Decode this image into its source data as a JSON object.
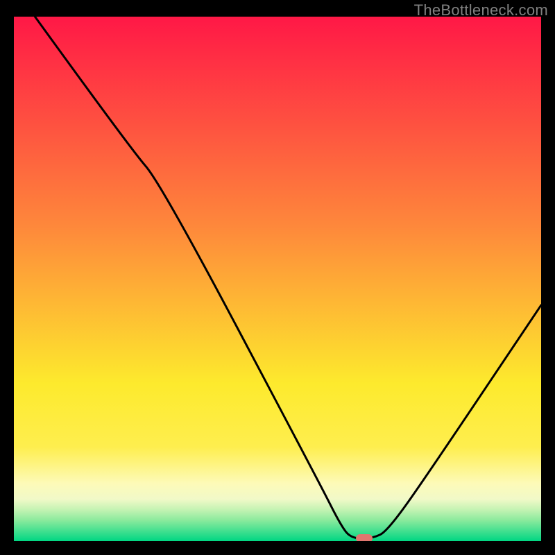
{
  "watermark": "TheBottleneck.com",
  "chart_data": {
    "type": "line",
    "title": "",
    "xlabel": "",
    "ylabel": "",
    "xlim": [
      0,
      100
    ],
    "ylim": [
      0,
      100
    ],
    "grid": false,
    "legend": false,
    "annotations": [],
    "background_gradient": {
      "stops": [
        {
          "offset": 0,
          "color": "#ff1846"
        },
        {
          "offset": 40,
          "color": "#fe883b"
        },
        {
          "offset": 70,
          "color": "#fdea2d"
        },
        {
          "offset": 82,
          "color": "#feee4e"
        },
        {
          "offset": 89,
          "color": "#fdfab8"
        },
        {
          "offset": 92,
          "color": "#f1f9c8"
        },
        {
          "offset": 94,
          "color": "#c4f3b3"
        },
        {
          "offset": 96,
          "color": "#8bea9d"
        },
        {
          "offset": 100,
          "color": "#00d683"
        }
      ]
    },
    "series": [
      {
        "name": "bottleneck-curve",
        "color": "#000000",
        "points": [
          {
            "x": 4,
            "y": 100
          },
          {
            "x": 22,
            "y": 75
          },
          {
            "x": 28,
            "y": 68
          },
          {
            "x": 58,
            "y": 11
          },
          {
            "x": 62,
            "y": 3
          },
          {
            "x": 64,
            "y": 0.5
          },
          {
            "x": 68,
            "y": 0.5
          },
          {
            "x": 71,
            "y": 2
          },
          {
            "x": 80,
            "y": 15
          },
          {
            "x": 100,
            "y": 45
          }
        ]
      }
    ],
    "marker": {
      "x": 66.5,
      "y": 0.5,
      "color": "#e0766f"
    }
  }
}
